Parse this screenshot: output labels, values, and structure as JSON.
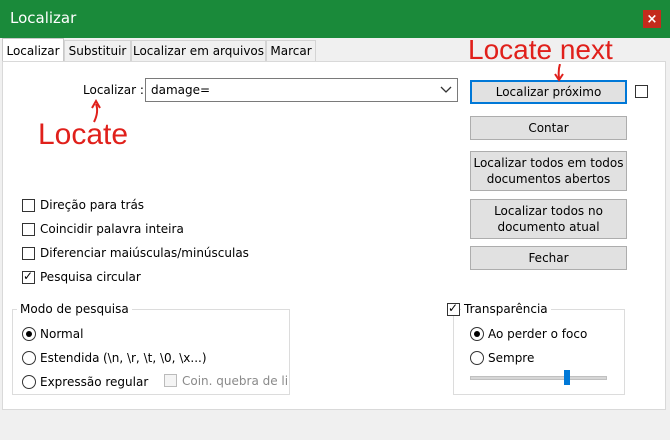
{
  "window": {
    "title": "Localizar",
    "close_glyph": "×"
  },
  "tabs": [
    {
      "label": "Localizar",
      "active": true
    },
    {
      "label": "Substituir",
      "active": false
    },
    {
      "label": "Localizar em arquivos",
      "active": false
    },
    {
      "label": "Marcar",
      "active": false
    }
  ],
  "search": {
    "label": "Localizar :",
    "value": "damage="
  },
  "buttons": {
    "find_next": "Localizar próximo",
    "count": "Contar",
    "find_all_open_line1": "Localizar todos em todos",
    "find_all_open_line2": "documentos abertos",
    "find_all_current_line1": "Localizar todos no",
    "find_all_current_line2": "documento atual",
    "close": "Fechar"
  },
  "options": {
    "backward": {
      "label": "Direção para trás",
      "checked": false
    },
    "whole_word": {
      "label": "Coincidir palavra inteira",
      "checked": false
    },
    "match_case": {
      "label": "Diferenciar maiúsculas/minúsculas",
      "checked": false
    },
    "wrap": {
      "label": "Pesquisa circular",
      "checked": true
    }
  },
  "search_mode": {
    "title": "Modo de pesquisa",
    "normal": "Normal",
    "extended": "Estendida",
    "extended_hint": "(\\n, \\r, \\t, \\0, \\x...)",
    "regex": "Expressão regular",
    "dot_newline": "Coin. quebra de li",
    "selected": "normal"
  },
  "transparency": {
    "title": "Transparência",
    "enabled": true,
    "on_lose_focus": "Ao perder o foco",
    "always": "Sempre",
    "selected": "on_lose_focus",
    "slider_level": 0.72
  },
  "annotations": {
    "locate_next": "Locate next",
    "locate": "Locate",
    "arrow_color": "#e0201b"
  }
}
